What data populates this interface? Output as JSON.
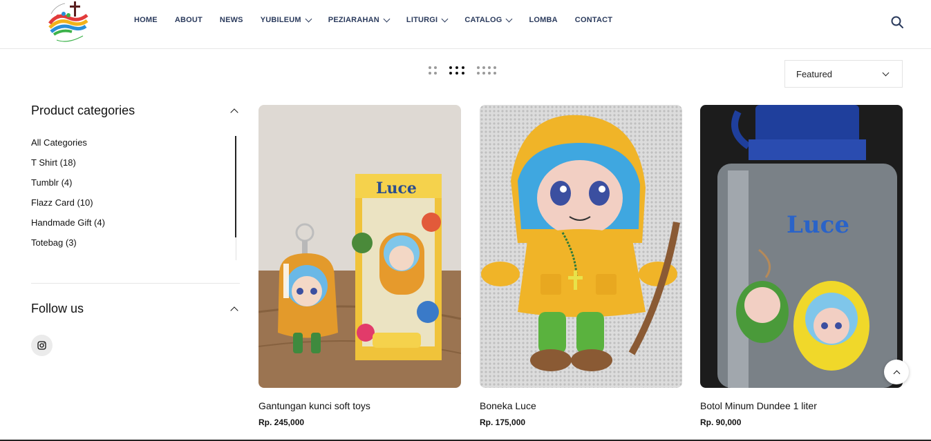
{
  "header": {
    "logo_text": "YUBILEUM",
    "nav": [
      {
        "label": "HOME",
        "dropdown": false
      },
      {
        "label": "ABOUT",
        "dropdown": false
      },
      {
        "label": "NEWS",
        "dropdown": false
      },
      {
        "label": "YUBILEUM",
        "dropdown": true
      },
      {
        "label": "PEZIARAHAN",
        "dropdown": true
      },
      {
        "label": "LITURGI",
        "dropdown": true
      },
      {
        "label": "CATALOG",
        "dropdown": true
      },
      {
        "label": "LOMBA",
        "dropdown": false
      },
      {
        "label": "CONTACT",
        "dropdown": false
      }
    ],
    "search_icon": "search-icon"
  },
  "toolbar": {
    "view_options": [
      "2-columns",
      "3-columns",
      "4-columns"
    ],
    "active_view": "3-columns",
    "sort_value": "Featured"
  },
  "sidebar": {
    "categories_title": "Product categories",
    "categories": [
      "All Categories",
      "T Shirt (18)",
      "Tumblr (4)",
      "Flazz Card (10)",
      "Handmade Gift (4)",
      "Totebag (3)"
    ],
    "follow_title": "Follow us",
    "social": [
      "instagram-icon"
    ]
  },
  "products": [
    {
      "name": "Gantungan kunci soft toys",
      "price": "Rp. 245,000"
    },
    {
      "name": "Boneka Luce",
      "price": "Rp. 175,000"
    },
    {
      "name": "Botol Minum Dundee 1 liter",
      "price": "Rp. 90,000"
    }
  ],
  "product_image_text": {
    "box_label": "Luce",
    "bottle_label": "Luce"
  },
  "colors": {
    "nav_text": "#2a3a5c",
    "text": "#111111",
    "divider": "#e6e6e6",
    "raincoat_yellow": "#f0b428",
    "hair_blue": "#3fa7e0"
  }
}
